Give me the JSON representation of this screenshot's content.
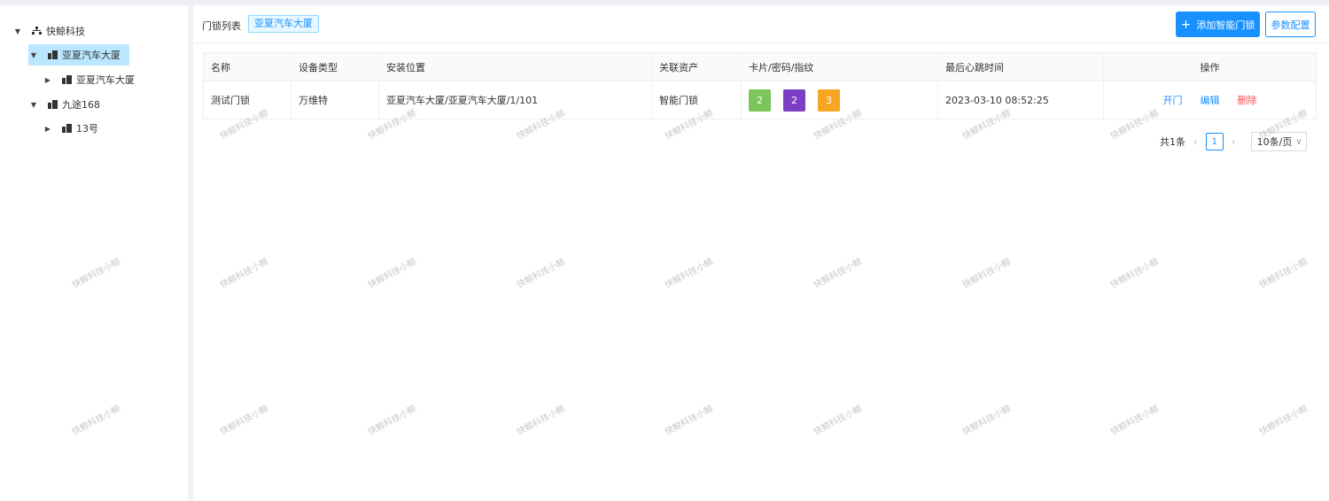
{
  "sidebar": {
    "tree": [
      {
        "label": "快鲸科技",
        "icon": "org-icon",
        "expanded": true
      },
      {
        "label": "亚夏汽车大厦",
        "icon": "building-icon",
        "expanded": true,
        "selected": true
      },
      {
        "label": "亚夏汽车大厦",
        "icon": "building-icon",
        "expanded": false
      },
      {
        "label": "九途168",
        "icon": "building-icon",
        "expanded": true
      },
      {
        "label": "13号",
        "icon": "building-icon",
        "expanded": false
      }
    ]
  },
  "header": {
    "title": "门锁列表",
    "tag": "亚夏汽车大厦",
    "add_button": "添加智能门锁",
    "param_button": "参数配置"
  },
  "table": {
    "columns": [
      "名称",
      "设备类型",
      "安装位置",
      "关联资产",
      "卡片/密码/指纹",
      "最后心跳时间",
      "操作"
    ],
    "rows": [
      {
        "name": "测试门锁",
        "type": "万维特",
        "location": "亚夏汽车大厦/亚夏汽车大厦/1/101",
        "asset": "智能门锁",
        "counts": [
          {
            "value": "2",
            "color": "#7cc55a"
          },
          {
            "value": "2",
            "color": "#7b3fc4"
          },
          {
            "value": "3",
            "color": "#f5a623"
          }
        ],
        "heartbeat": "2023-03-10 08:52:25",
        "actions": {
          "open": "开门",
          "edit": "编辑",
          "delete": "删除"
        }
      }
    ]
  },
  "pagination": {
    "total": "共1条",
    "current_page": "1",
    "page_size": "10条/页"
  },
  "watermark": "快鲸科技小鲸",
  "colors": {
    "primary": "#1890ff",
    "danger": "#ff4d4f",
    "selected_bg": "#bae7ff"
  }
}
